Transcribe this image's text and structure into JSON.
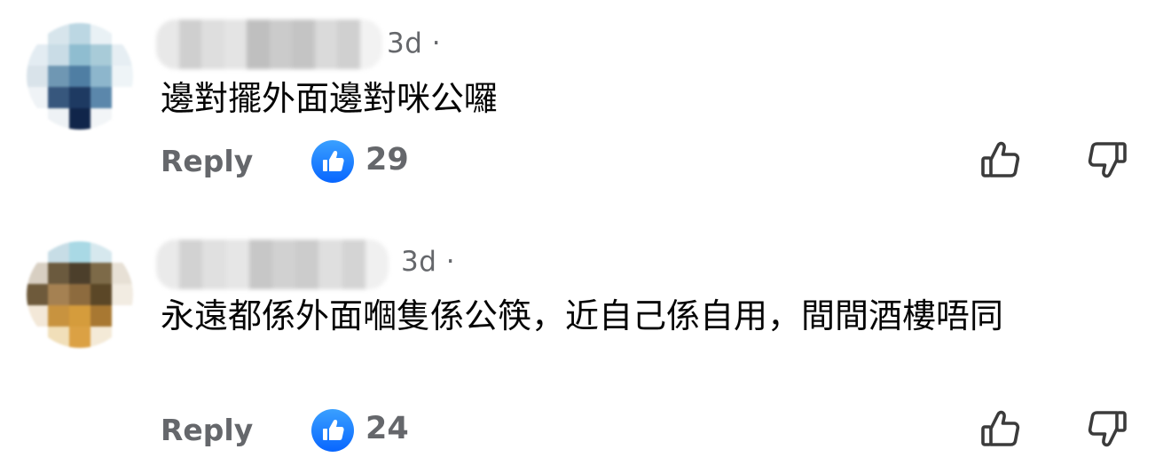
{
  "comments": [
    {
      "timestamp": "3d ·",
      "text": "邊對擺外面邊對咪公囉",
      "reply_label": "Reply",
      "like_count": "29",
      "avatar_colors": [
        "#ffffff",
        "#d7e5ec",
        "#bcd7e3",
        "#e9f1f5",
        "#ffffff",
        "#e3ecf2",
        "#c9dce6",
        "#8fbdd0",
        "#a8cbd8",
        "#e6eef3",
        "#d9e3ea",
        "#6f97b3",
        "#4f7ea3",
        "#8db6cc",
        "#eef4f7",
        "#eff3f6",
        "#37577d",
        "#1e3a62",
        "#5b87ab",
        "#ffffff",
        "#ffffff",
        "#eef2f5",
        "#10254a",
        "#f2f5f7",
        "#ffffff"
      ],
      "name_blur_colors": [
        "#e8e8e8",
        "#cfcfcf",
        "#dedede",
        "#e4e4e4",
        "#bfbfbf",
        "#cbcbcb",
        "#c4c4c4",
        "#dadada",
        "#d0d0d0",
        "#f2f2f2"
      ]
    },
    {
      "timestamp": "3d ·",
      "text": "永遠都係外面嗰隻係公筷，近自己係自用，間間酒樓唔同",
      "reply_label": "Reply",
      "like_count": "24",
      "avatar_colors": [
        "#ffffff",
        "#c7dde6",
        "#a9d9e5",
        "#d6e8ee",
        "#ffffff",
        "#d8cfc2",
        "#6b5a3e",
        "#4c3f2b",
        "#7d6a48",
        "#e7e0d5",
        "#6e5a3b",
        "#a58152",
        "#8d6b3e",
        "#5b4727",
        "#f2ece2",
        "#f3e8d8",
        "#c8933f",
        "#d59c3c",
        "#a87832",
        "#ffffff",
        "#ffffff",
        "#f1dfb9",
        "#dba144",
        "#f4ead7",
        "#ffffff"
      ],
      "name_blur_colors": [
        "#eaeaea",
        "#d2d2d2",
        "#e0e0e0",
        "#e6e6e6",
        "#c7c7c7",
        "#d1d1d1",
        "#cccccc",
        "#dfdfdf",
        "#d4d4d4",
        "#f0f0f0"
      ]
    }
  ],
  "icons": {
    "like_badge": "thumbs-up-icon",
    "like_button": "thumbs-up-outline-icon",
    "dislike_button": "thumbs-down-outline-icon"
  },
  "colors": {
    "accent": "#0866ff",
    "secondary_text": "#65676b",
    "primary_text": "#050505"
  }
}
